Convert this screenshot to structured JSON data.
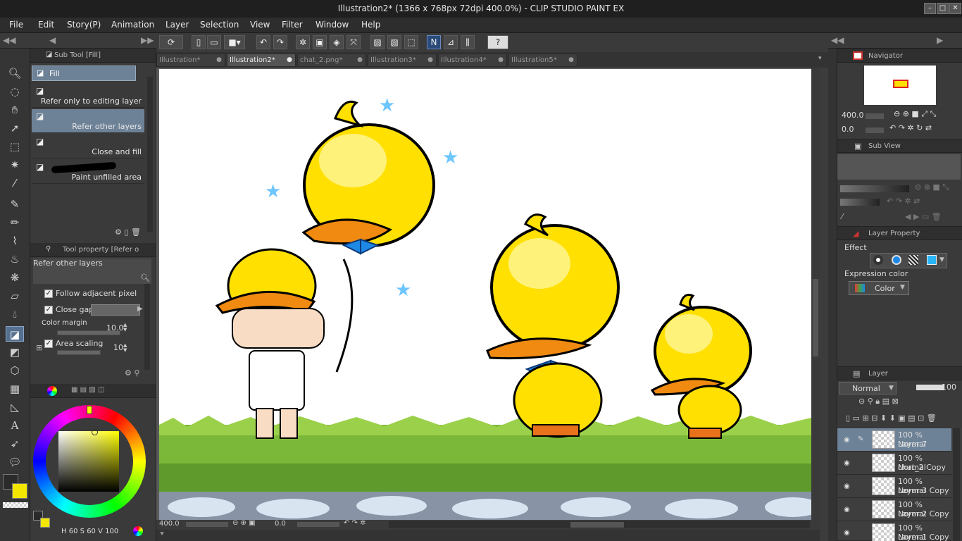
{
  "window": {
    "title": "Illustration2* (1366 x 768px 72dpi 400.0%)  - CLIP STUDIO PAINT EX"
  },
  "menu": [
    "File",
    "Edit",
    "Story(P)",
    "Animation",
    "Layer",
    "Selection",
    "View",
    "Filter",
    "Window",
    "Help"
  ],
  "tabs": [
    {
      "label": "Illustration*"
    },
    {
      "label": "Illustration2*"
    },
    {
      "label": "chat_2.png*"
    },
    {
      "label": "Illustration3*"
    },
    {
      "label": "Illustration4*"
    },
    {
      "label": "Illustration5*"
    }
  ],
  "subtool": {
    "title": "Sub Tool [Fill]",
    "group": "Fill",
    "items": [
      "Refer only to editing layer",
      "Refer other layers",
      "Close and fill",
      "Paint unfilled area"
    ]
  },
  "toolprop": {
    "title": "Tool property [Refer o",
    "name": "Refer other layers",
    "follow_adjacent": "Follow adjacent pixel",
    "close_gap": "Close gap",
    "color_margin": "Color margin",
    "color_margin_value": "10.0",
    "area_scaling": "Area scaling",
    "area_scaling_value": "10"
  },
  "color": {
    "h_label": "H",
    "h": "60",
    "s_label": "S",
    "s": "60",
    "v_label": "V",
    "v": "100",
    "main": "#2b2b2b",
    "sub": "#f3e600"
  },
  "navigator": {
    "title": "Navigator",
    "zoom": "400.0",
    "angle": "0.0"
  },
  "subview": {
    "title": "Sub View"
  },
  "layerprop": {
    "title": "Layer Property",
    "effect": "Effect",
    "expression": "Expression color",
    "color_value": "Color"
  },
  "layers": {
    "title": "Layer",
    "blend": "Normal",
    "opacity": "100",
    "items": [
      {
        "meta": "100 % Normal",
        "name": "Layer 7"
      },
      {
        "meta": "100 % Normal",
        "name": "chat_2 Copy"
      },
      {
        "meta": "100 % Normal",
        "name": "Layer 3 Copy"
      },
      {
        "meta": "100 % Normal",
        "name": "Layer 2 Copy"
      },
      {
        "meta": "100 % Normal",
        "name": "Layer 1 Copy"
      }
    ]
  },
  "status": {
    "zoom": "400.0",
    "angle": "0.0"
  },
  "colors": {
    "accent": "#6e8297",
    "selected_tab": "#555555"
  }
}
